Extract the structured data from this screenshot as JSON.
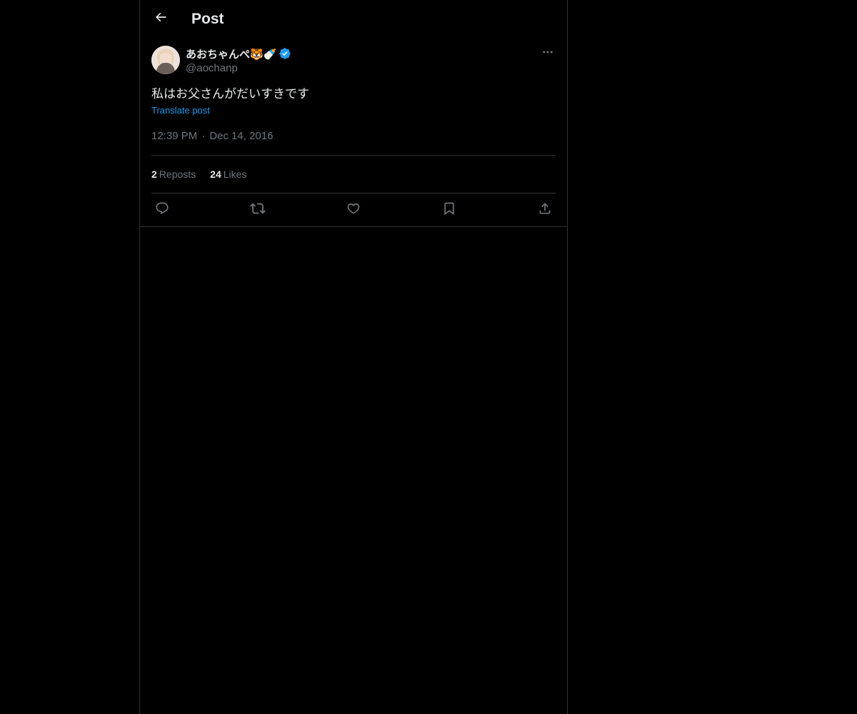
{
  "header": {
    "title": "Post"
  },
  "post": {
    "author": {
      "display_name": "あおちゃんぺ🐯🍼",
      "handle": "@aochanp",
      "verified": true
    },
    "text": "私はお父さんがだいすきです",
    "translate_label": "Translate post",
    "time": "12:39 PM",
    "separator": "·",
    "date": "Dec 14, 2016",
    "stats": {
      "reposts_count": "2",
      "reposts_label": "Reposts",
      "likes_count": "24",
      "likes_label": "Likes"
    },
    "actions": [
      "reply-icon",
      "repost-icon",
      "like-icon",
      "bookmark-icon",
      "share-icon"
    ]
  },
  "colors": {
    "background": "#000000",
    "text": "#e7e9ea",
    "muted": "#71767b",
    "accent": "#1d9bf0",
    "border": "#2f3336"
  }
}
